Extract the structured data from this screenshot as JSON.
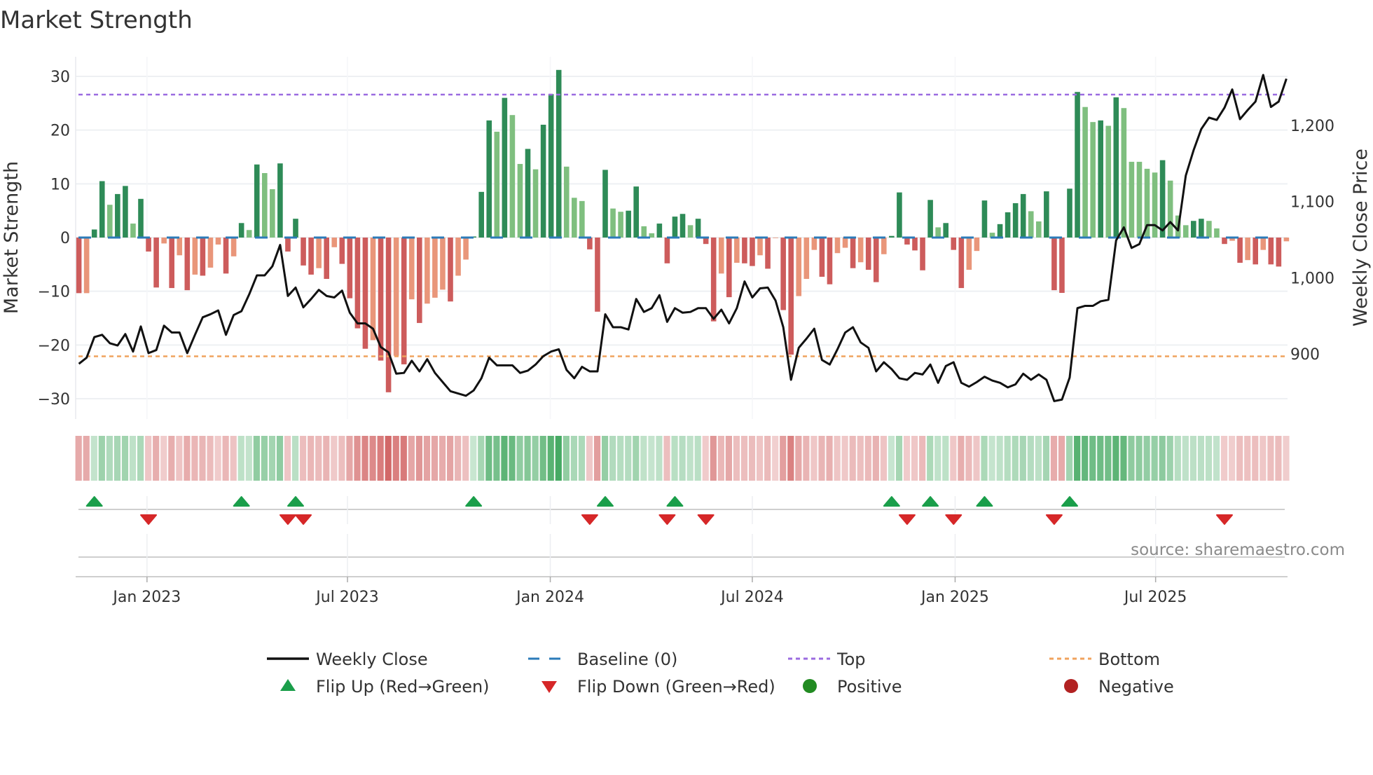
{
  "chart_data": {
    "type": "bar",
    "title": "Market Strength",
    "ylabel": "Market Strength",
    "y2label": "Weekly Close Price",
    "ylim": [
      -32,
      32
    ],
    "y2lim": [
      823,
      1285
    ],
    "yticks": [
      {
        "v": 30,
        "label": "30"
      },
      {
        "v": 20,
        "label": "20"
      },
      {
        "v": 10,
        "label": "10"
      },
      {
        "v": 0,
        "label": "0"
      },
      {
        "v": -10,
        "label": "−10"
      },
      {
        "v": -20,
        "label": "−20"
      },
      {
        "v": -30,
        "label": "−30"
      }
    ],
    "y2ticks": [
      {
        "v": 1200,
        "label": "1,200"
      },
      {
        "v": 1100,
        "label": "1,100"
      },
      {
        "v": 1000,
        "label": "1,000"
      },
      {
        "v": 900,
        "label": "900"
      }
    ],
    "xticks": [
      {
        "week": 8.8,
        "label": "Jan 2023"
      },
      {
        "week": 34.7,
        "label": "Jul 2023"
      },
      {
        "week": 60.9,
        "label": "Jan 2024"
      },
      {
        "week": 87.0,
        "label": "Jul 2024"
      },
      {
        "week": 113.2,
        "label": "Jan 2025"
      },
      {
        "week": 139.1,
        "label": "Jul 2025"
      }
    ],
    "top_level": 26.6,
    "bottom_level": -22.1,
    "strength": [
      -10.35,
      -10.35,
      1.5,
      10.5,
      6.1,
      8.1,
      9.6,
      2.6,
      7.2,
      -2.6,
      -9.3,
      -1.1,
      -9.4,
      -3.3,
      -9.8,
      -6.9,
      -7.1,
      -5.6,
      -1.3,
      -6.7,
      -3.5,
      2.7,
      1.4,
      13.6,
      12,
      9,
      13.8,
      -2.6,
      3.5,
      -5.2,
      -6.9,
      -5.7,
      -7.7,
      -1.8,
      -4.9,
      -11.3,
      -16.9,
      -20.7,
      -19.1,
      -22.9,
      -28.8,
      -22,
      -23.6,
      -11.5,
      -15.9,
      -12.3,
      -11.2,
      -9.7,
      -11.9,
      -7.1,
      -4.1,
      0.2,
      8.5,
      21.8,
      19.7,
      26,
      22.8,
      13.7,
      16.5,
      12.7,
      21,
      26.7,
      31.2,
      13.2,
      7.4,
      6.8,
      -2.2,
      -13.8,
      12.6,
      5.4,
      4.8,
      5,
      9.5,
      2.1,
      0.8,
      2.6,
      -4.8,
      3.9,
      4.4,
      2.3,
      3.5,
      -1.2,
      -15.6,
      -6.7,
      -11.1,
      -4.7,
      -4.8,
      -5.3,
      -3.3,
      -5.8,
      -0.1,
      -13.5,
      -21.8,
      -10.9,
      -7.7,
      -2.3,
      -7.3,
      -8.7,
      -2.9,
      -1.9,
      -5.7,
      -4.6,
      -6,
      -8.3,
      -3.1,
      0.3,
      8.4,
      -1.3,
      -2.4,
      -6.1,
      7,
      1.9,
      2.7,
      -2.3,
      -9.4,
      -6,
      -2.5,
      6.9,
      0.9,
      2.5,
      4.7,
      6.4,
      8.1,
      4.9,
      3,
      8.6,
      -9.8,
      -10.3,
      9.1,
      27.1,
      24.3,
      21.5,
      21.8,
      20.8,
      26.1,
      24.1,
      14.1,
      14.1,
      12.8,
      12.1,
      14.4,
      10.6,
      4.1,
      2.3,
      3.1,
      3.5,
      3.1,
      1.7,
      -1.2,
      -0.6,
      -4.7,
      -4.2,
      -5,
      -2.3,
      -5,
      -5.4,
      -0.7
    ],
    "weekly_close": [
      887,
      895,
      922,
      925,
      914,
      911,
      926,
      903,
      936,
      901,
      905,
      937,
      928,
      928,
      901,
      925,
      948,
      952,
      957,
      925,
      951,
      956,
      978,
      1003,
      1003,
      1015,
      1043,
      976,
      987,
      961,
      972,
      984,
      976,
      974,
      983,
      954,
      940,
      940,
      933,
      909,
      902,
      874,
      875,
      891,
      877,
      893,
      875,
      863,
      851,
      848,
      845,
      852,
      868,
      895,
      885,
      885,
      885,
      875,
      878,
      886,
      897,
      903,
      906,
      879,
      868,
      883,
      877,
      877,
      952,
      935,
      935,
      932,
      972,
      955,
      960,
      977,
      942,
      960,
      954,
      955,
      960,
      960,
      946,
      958,
      940,
      960,
      995,
      974,
      986,
      987,
      970,
      935,
      866,
      908,
      920,
      933,
      892,
      886,
      906,
      928,
      935,
      915,
      908,
      877,
      889,
      880,
      868,
      866,
      875,
      873,
      886,
      862,
      884,
      889,
      862,
      857,
      863,
      870,
      865,
      862,
      856,
      860,
      874,
      866,
      873,
      866,
      838,
      840,
      869,
      960,
      963,
      963,
      969,
      971,
      1049,
      1066,
      1039,
      1044,
      1069,
      1069,
      1062,
      1073,
      1062,
      1134,
      1167,
      1195,
      1210,
      1207,
      1223,
      1247,
      1208,
      1220,
      1231,
      1266,
      1224,
      1231,
      1261
    ],
    "flip_up_weeks": [
      2,
      21,
      28,
      51,
      68,
      77,
      105,
      110,
      117,
      128
    ],
    "flip_down_weeks": [
      9,
      27,
      29,
      66,
      76,
      81,
      107,
      113,
      126,
      148
    ],
    "legend": [
      {
        "label": "Weekly Close",
        "kind": "line",
        "color": "#111111"
      },
      {
        "label": "Baseline (0)",
        "kind": "dash",
        "color": "#2b7bb9"
      },
      {
        "label": "Top",
        "kind": "dot",
        "color": "#9b6be0"
      },
      {
        "label": "Bottom",
        "kind": "dot",
        "color": "#f0a35e"
      },
      {
        "label": "Flip Up (Red→Green)",
        "kind": "up",
        "color": "#1a9e4a"
      },
      {
        "label": "Flip Down (Green→Red)",
        "kind": "down",
        "color": "#d62728"
      },
      {
        "label": "Positive",
        "kind": "circle",
        "color": "#228b22"
      },
      {
        "label": "Negative",
        "kind": "circle",
        "color": "#b22222"
      }
    ],
    "legend_placement": "bottom",
    "colors": {
      "pos_dark": "#2e8b57",
      "pos_light": "#7fbf7f",
      "neg_dark": "#cd5c5c",
      "neg_light": "#e9967a"
    },
    "source": "source: sharemaestro.com"
  }
}
